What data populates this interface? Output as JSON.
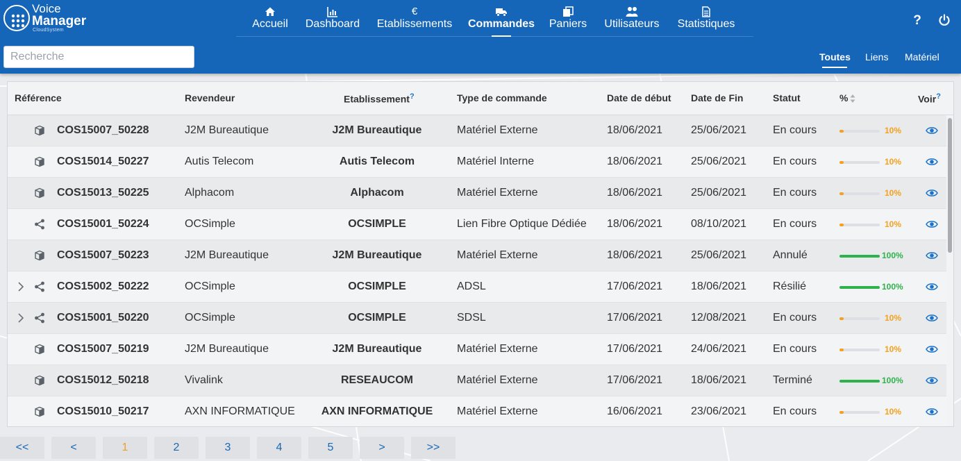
{
  "app": {
    "logo_line1": "Voice",
    "logo_line2": "Manager",
    "logo_line3": "CloudSystem"
  },
  "nav": [
    {
      "label": "Accueil",
      "icon": "home-icon"
    },
    {
      "label": "Dashboard",
      "icon": "chart-icon"
    },
    {
      "label": "Etablissements",
      "icon": "euro-icon",
      "glyph": "€"
    },
    {
      "label": "Commandes",
      "icon": "truck-icon",
      "active": true
    },
    {
      "label": "Paniers",
      "icon": "copy-icon"
    },
    {
      "label": "Utilisateurs",
      "icon": "users-icon"
    },
    {
      "label": "Statistiques",
      "icon": "document-icon"
    }
  ],
  "header": {
    "help_glyph": "?",
    "search_placeholder": "Recherche"
  },
  "filters": [
    {
      "label": "Toutes",
      "active": true
    },
    {
      "label": "Liens"
    },
    {
      "label": "Matériel"
    }
  ],
  "table": {
    "columns": {
      "reference": "Référence",
      "revendeur": "Revendeur",
      "etablissement": "Etablissement",
      "etablissement_help": "?",
      "type": "Type de commande",
      "debut": "Date de début",
      "fin": "Date de Fin",
      "statut": "Statut",
      "percent": "%",
      "voir": "Voir",
      "voir_help": "?"
    },
    "rows": [
      {
        "kind": "box",
        "expandable": false,
        "ref": "COS15007_50228",
        "revendeur": "J2M Bureautique",
        "etab": "J2M Bureautique",
        "type": "Matériel Externe",
        "debut": "18/06/2021",
        "fin": "25/06/2021",
        "statut": "En cours",
        "progress": 10,
        "progress_label": "10%"
      },
      {
        "kind": "box",
        "expandable": false,
        "ref": "COS15014_50227",
        "revendeur": "Autis Telecom",
        "etab": "Autis Telecom",
        "type": "Matériel Interne",
        "debut": "18/06/2021",
        "fin": "25/06/2021",
        "statut": "En cours",
        "progress": 10,
        "progress_label": "10%"
      },
      {
        "kind": "box",
        "expandable": false,
        "ref": "COS15013_50225",
        "revendeur": "Alphacom",
        "etab": "Alphacom",
        "type": "Matériel Externe",
        "debut": "18/06/2021",
        "fin": "25/06/2021",
        "statut": "En cours",
        "progress": 10,
        "progress_label": "10%"
      },
      {
        "kind": "share",
        "expandable": false,
        "ref": "COS15001_50224",
        "revendeur": "OCSimple",
        "etab": "OCSIMPLE",
        "type": "Lien Fibre Optique Dédiée",
        "debut": "18/06/2021",
        "fin": "08/10/2021",
        "statut": "En cours",
        "progress": 10,
        "progress_label": "10%"
      },
      {
        "kind": "box",
        "expandable": false,
        "ref": "COS15007_50223",
        "revendeur": "J2M Bureautique",
        "etab": "J2M Bureautique",
        "type": "Matériel Externe",
        "debut": "18/06/2021",
        "fin": "25/06/2021",
        "statut": "Annulé",
        "progress": 100,
        "progress_label": "100%"
      },
      {
        "kind": "share",
        "expandable": true,
        "ref": "COS15002_50222",
        "revendeur": "OCSimple",
        "etab": "OCSIMPLE",
        "type": "ADSL",
        "debut": "17/06/2021",
        "fin": "18/06/2021",
        "statut": "Résilié",
        "progress": 100,
        "progress_label": "100%"
      },
      {
        "kind": "share",
        "expandable": true,
        "ref": "COS15001_50220",
        "revendeur": "OCSimple",
        "etab": "OCSIMPLE",
        "type": "SDSL",
        "debut": "17/06/2021",
        "fin": "12/08/2021",
        "statut": "En cours",
        "progress": 10,
        "progress_label": "10%"
      },
      {
        "kind": "box",
        "expandable": false,
        "ref": "COS15007_50219",
        "revendeur": "J2M Bureautique",
        "etab": "J2M Bureautique",
        "type": "Matériel Externe",
        "debut": "17/06/2021",
        "fin": "24/06/2021",
        "statut": "En cours",
        "progress": 10,
        "progress_label": "10%"
      },
      {
        "kind": "box",
        "expandable": false,
        "ref": "COS15012_50218",
        "revendeur": "Vivalink",
        "etab": "RESEAUCOM",
        "type": "Matériel Externe",
        "debut": "17/06/2021",
        "fin": "18/06/2021",
        "statut": "Terminé",
        "progress": 100,
        "progress_label": "100%"
      },
      {
        "kind": "box",
        "expandable": false,
        "ref": "COS15010_50217",
        "revendeur": "AXN INFORMATIQUE",
        "etab": "AXN INFORMATIQUE",
        "type": "Matériel Externe",
        "debut": "16/06/2021",
        "fin": "23/06/2021",
        "statut": "En cours",
        "progress": 10,
        "progress_label": "10%"
      }
    ]
  },
  "pagination": [
    {
      "label": "<<"
    },
    {
      "label": "<"
    },
    {
      "label": "1",
      "active": true
    },
    {
      "label": "2"
    },
    {
      "label": "3"
    },
    {
      "label": "4"
    },
    {
      "label": "5"
    },
    {
      "label": ">"
    },
    {
      "label": ">>"
    }
  ],
  "colors": {
    "header_bg": "#1565b8",
    "progress_low": "#f5a11f",
    "progress_full": "#2eb24c",
    "link_blue": "#1a73c9",
    "pager_active": "#f0a020"
  }
}
